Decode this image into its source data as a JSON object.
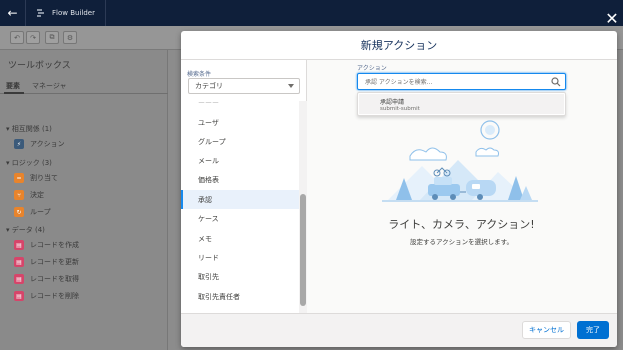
{
  "topbar": {
    "app_title": "Flow Builder"
  },
  "toolbox": {
    "title": "ツールボックス",
    "tabs": [
      "要素",
      "マネージャ"
    ],
    "sections": [
      {
        "label": "相互関係 (1)",
        "items": [
          {
            "label": "アクション",
            "icon": "lightning-icon",
            "color": "#3b5a7a"
          }
        ]
      },
      {
        "label": "ロジック (3)",
        "items": [
          {
            "label": "割り当て",
            "icon": "equals-icon",
            "color": "#e8842c"
          },
          {
            "label": "決定",
            "icon": "decision-icon",
            "color": "#e8842c"
          },
          {
            "label": "ループ",
            "icon": "loop-icon",
            "color": "#e8842c"
          }
        ]
      },
      {
        "label": "データ (4)",
        "items": [
          {
            "label": "レコードを作成",
            "icon": "record-create-icon",
            "color": "#d6456a"
          },
          {
            "label": "レコードを更新",
            "icon": "record-update-icon",
            "color": "#d6456a"
          },
          {
            "label": "レコードを取得",
            "icon": "record-lookup-icon",
            "color": "#d6456a"
          },
          {
            "label": "レコードを削除",
            "icon": "record-delete-icon",
            "color": "#d6456a"
          }
        ]
      }
    ]
  },
  "modal": {
    "title": "新規アクション",
    "filter": {
      "label": "検索条件",
      "select_value": "カテゴリ",
      "items": [
        "ユーザ",
        "グループ",
        "メール",
        "価格表",
        "承認",
        "ケース",
        "メモ",
        "リード",
        "取引先",
        "取引先責任者"
      ],
      "selected": "承認"
    },
    "action": {
      "label": "アクション",
      "search_placeholder": "承認 アクションを検索...",
      "result_title": "承認申請",
      "result_subtitle": "submit-submit"
    },
    "empty": {
      "heading": "ライト、カメラ、アクション!",
      "subtext": "設定するアクションを選択します。"
    },
    "footer": {
      "cancel_label": "キャンセル",
      "done_label": "完了"
    }
  },
  "colors": {
    "accent": "#0070d2",
    "topbar": "#0f1f3a"
  }
}
